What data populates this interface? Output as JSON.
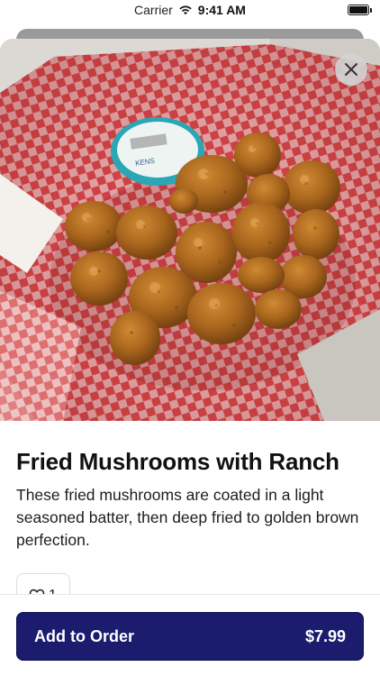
{
  "status_bar": {
    "carrier": "Carrier",
    "time": "9:41 AM"
  },
  "item": {
    "title": "Fried Mushrooms with Ranch",
    "description": "These fried mushrooms are coated in a light seasoned batter, then deep fried to golden brown perfection.",
    "like_count": "1",
    "image_subject": "fried mushrooms in a red-checkered paper basket with a ranch dressing cup"
  },
  "footer": {
    "button_label": "Add to Order",
    "price": "$7.99"
  },
  "colors": {
    "primary_button": "#1b1c6e",
    "checker_red": "#d9474a",
    "mushroom_brown": "#a8651d"
  },
  "icons": {
    "close": "close-icon",
    "like": "heart-icon",
    "wifi": "wifi-icon",
    "battery": "battery-icon"
  }
}
